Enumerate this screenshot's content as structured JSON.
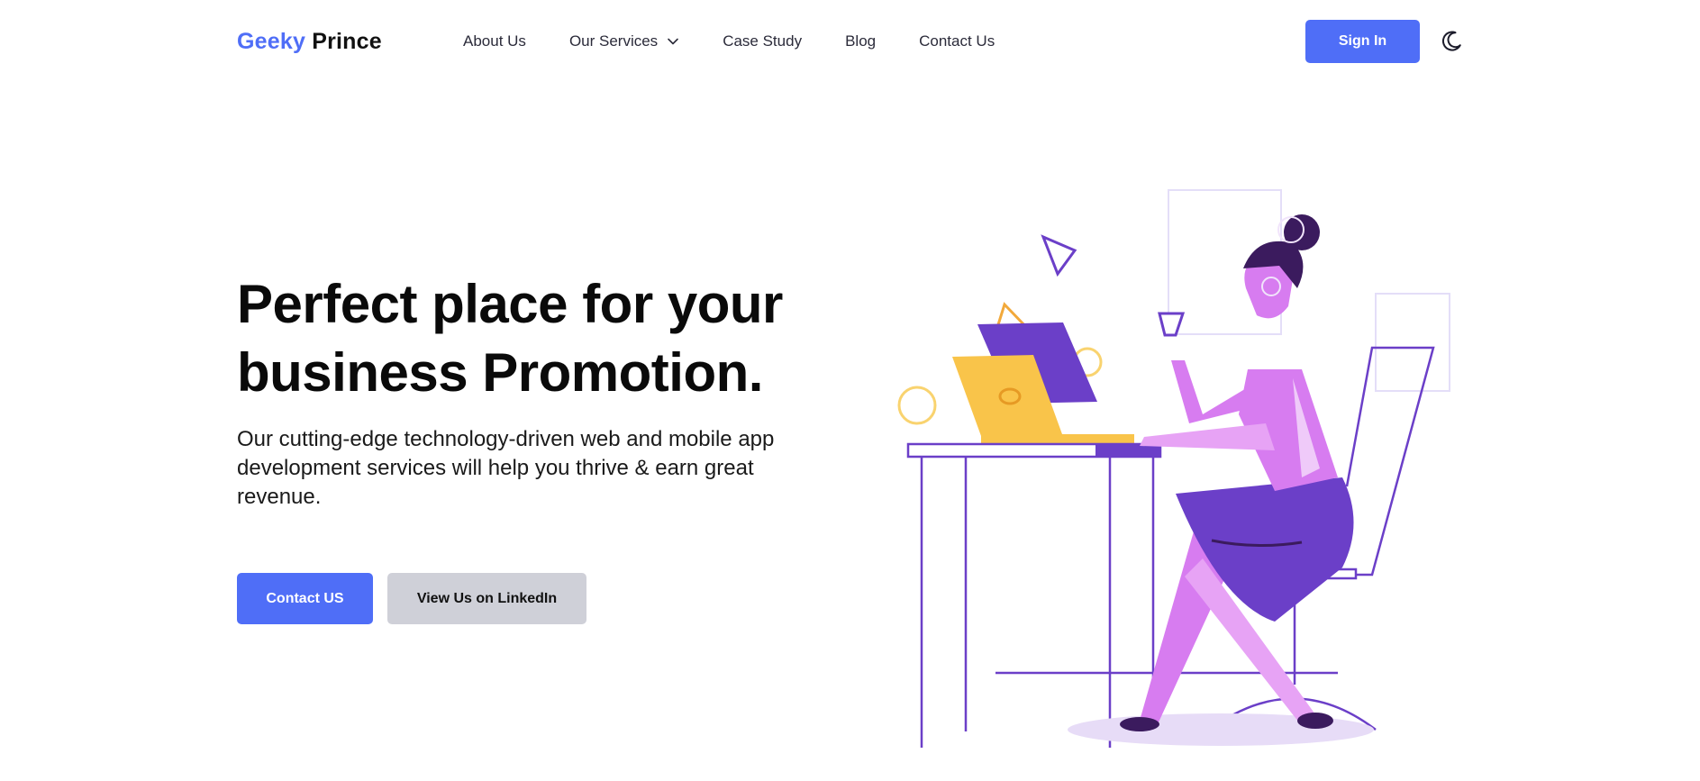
{
  "brand": {
    "first": "Geeky",
    "second": "Prince"
  },
  "nav": {
    "items": [
      {
        "label": "About Us"
      },
      {
        "label": "Our Services"
      },
      {
        "label": "Case Study"
      },
      {
        "label": "Blog"
      },
      {
        "label": "Contact Us"
      }
    ],
    "signin_label": "Sign In",
    "theme_toggle_icon": "moon-icon"
  },
  "hero": {
    "title": "Perfect place for your business Promotion.",
    "subtitle": "Our cutting-edge technology-driven web and mobile app development services will help you thrive & earn great revenue.",
    "primary_cta": "Contact US",
    "secondary_cta": "View Us on LinkedIn"
  },
  "colors": {
    "accent": "#4f6ef7",
    "secondary_button": "#cfd0d8",
    "illustration_purple": "#6b3fc8",
    "illustration_pink": "#d77cf0",
    "illustration_yellow": "#f9c44a"
  }
}
